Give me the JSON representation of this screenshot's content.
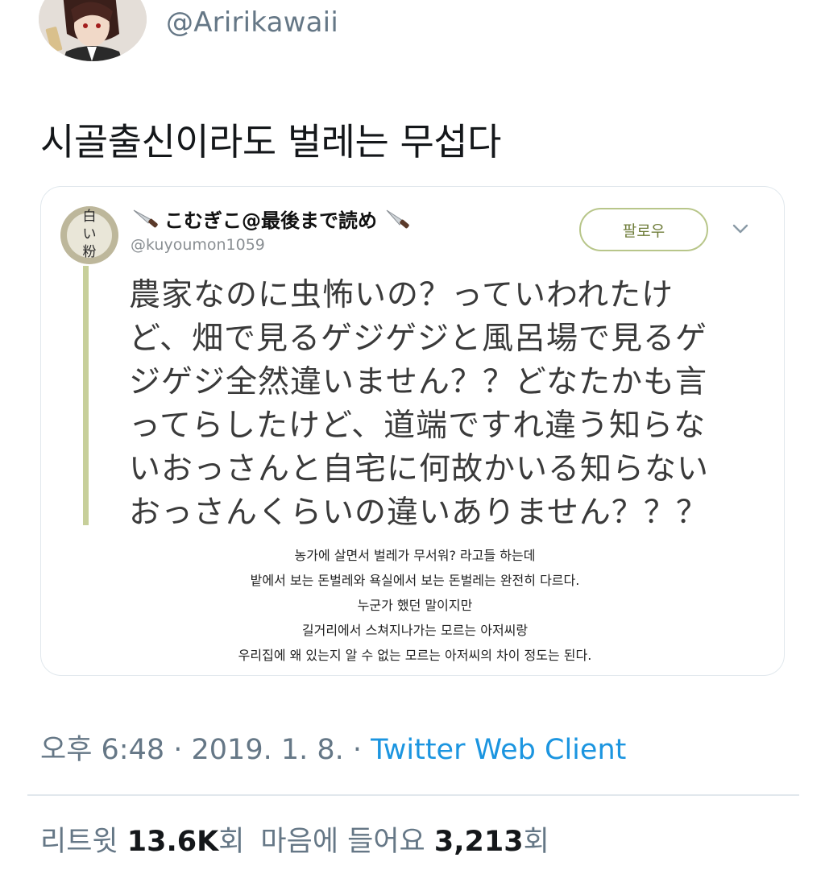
{
  "author": {
    "handle": "@Aririkawaii",
    "avatar_icon": "anime-character-avatar"
  },
  "tweet": {
    "text": "시골출신이라도 벌레는 무섭다"
  },
  "quoted": {
    "display_name": "こむぎこ@最後まで読め",
    "handle": "@kuyoumon1059",
    "follow_label": "팔로우",
    "avatar_text": "白い粉",
    "body_lines": [
      "農家なのに虫怖いの？っていわれたけ",
      "ど、畑で見るゲジゲジと風呂場で見るゲ",
      "ジゲジ全然違いません？？どなたかも言",
      "ってらしたけど、道端ですれ違う知らな",
      "いおっさんと自宅に何故かいる知らない",
      "おっさんくらいの違いありません？？？"
    ],
    "translation_lines": [
      "농가에 살면서 벌레가 무서워? 라고들 하는데",
      "밭에서 보는 돈벌레와 욕실에서 보는 돈벌레는 완전히 다르다.",
      "누군가 했던 말이지만",
      "길거리에서 스쳐지나가는 모르는 아저씨랑",
      "우리집에 왜 있는지 알 수 없는 모르는 아저씨의 차이 정도는 된다."
    ]
  },
  "meta": {
    "time": "오후 6:48",
    "sep1": " · ",
    "date": "2019. 1. 8.",
    "sep2": " · ",
    "client": "Twitter Web Client"
  },
  "stats": {
    "retweet_label": "리트윗 ",
    "retweet_count": "13.6K",
    "retweet_suffix": "회",
    "like_label": "마음에 들어요 ",
    "like_count": "3,213",
    "like_suffix": "회"
  },
  "colors": {
    "link": "#1b95e0",
    "muted": "#657786",
    "quote_bar": "#c7cf9a"
  }
}
